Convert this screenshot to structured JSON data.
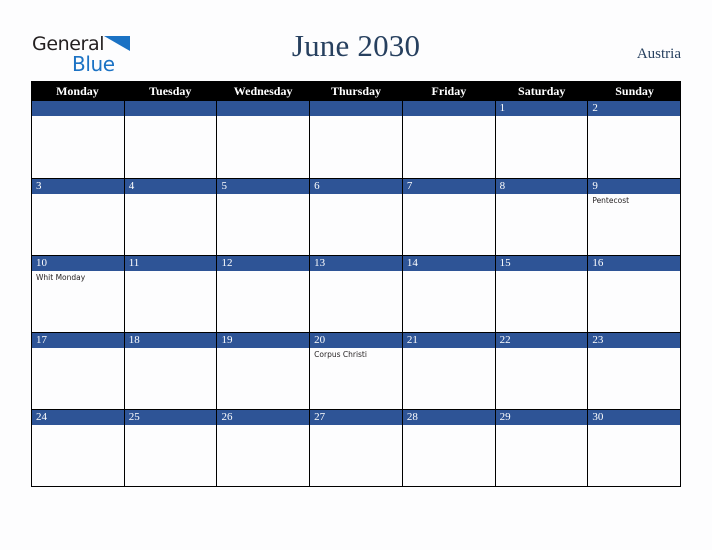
{
  "brand": {
    "name_part1": "General",
    "name_part2": "Blue",
    "triangle_icon": "blue-triangle-icon",
    "color_dark": "#231f20",
    "color_blue": "#1b72c4"
  },
  "header": {
    "title": "June 2030",
    "country": "Austria",
    "title_color": "#27405f"
  },
  "theme": {
    "accent_blue": "#2e5496",
    "header_bar": "#000000",
    "page_background": "#fdfdfe",
    "grid_line": "#000000"
  },
  "calendar": {
    "month": "June",
    "year": "2030",
    "weekday_headers": [
      "Monday",
      "Tuesday",
      "Wednesday",
      "Thursday",
      "Friday",
      "Saturday",
      "Sunday"
    ],
    "weeks": [
      {
        "days": [
          {
            "num": "",
            "events": []
          },
          {
            "num": "",
            "events": []
          },
          {
            "num": "",
            "events": []
          },
          {
            "num": "",
            "events": []
          },
          {
            "num": "",
            "events": []
          },
          {
            "num": "1",
            "events": []
          },
          {
            "num": "2",
            "events": []
          }
        ]
      },
      {
        "days": [
          {
            "num": "3",
            "events": []
          },
          {
            "num": "4",
            "events": []
          },
          {
            "num": "5",
            "events": []
          },
          {
            "num": "6",
            "events": []
          },
          {
            "num": "7",
            "events": []
          },
          {
            "num": "8",
            "events": []
          },
          {
            "num": "9",
            "events": [
              "Pentecost"
            ]
          }
        ]
      },
      {
        "days": [
          {
            "num": "10",
            "events": [
              "Whit Monday"
            ]
          },
          {
            "num": "11",
            "events": []
          },
          {
            "num": "12",
            "events": []
          },
          {
            "num": "13",
            "events": []
          },
          {
            "num": "14",
            "events": []
          },
          {
            "num": "15",
            "events": []
          },
          {
            "num": "16",
            "events": []
          }
        ]
      },
      {
        "days": [
          {
            "num": "17",
            "events": []
          },
          {
            "num": "18",
            "events": []
          },
          {
            "num": "19",
            "events": []
          },
          {
            "num": "20",
            "events": [
              "Corpus Christi"
            ]
          },
          {
            "num": "21",
            "events": []
          },
          {
            "num": "22",
            "events": []
          },
          {
            "num": "23",
            "events": []
          }
        ]
      },
      {
        "days": [
          {
            "num": "24",
            "events": []
          },
          {
            "num": "25",
            "events": []
          },
          {
            "num": "26",
            "events": []
          },
          {
            "num": "27",
            "events": []
          },
          {
            "num": "28",
            "events": []
          },
          {
            "num": "29",
            "events": []
          },
          {
            "num": "30",
            "events": []
          }
        ]
      }
    ]
  }
}
